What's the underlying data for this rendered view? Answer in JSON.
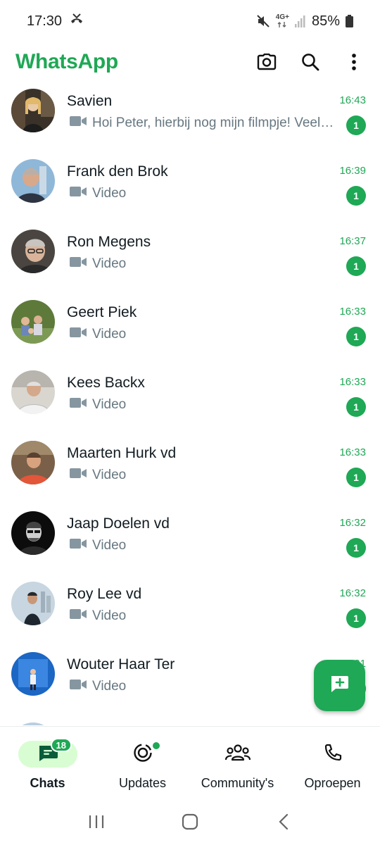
{
  "status_bar": {
    "time": "17:30",
    "network": "4G+",
    "battery": "85%"
  },
  "app": {
    "title": "WhatsApp",
    "camera_icon": "camera-icon",
    "search_icon": "search-icon",
    "menu_icon": "more-vert-icon"
  },
  "chats": [
    {
      "name": "Savien",
      "time": "16:43",
      "preview": "Hoi Peter, hierbij nog mijn filmpje! Veel succes",
      "unread": "1"
    },
    {
      "name": "Frank den Brok",
      "time": "16:39",
      "preview": "Video",
      "unread": "1"
    },
    {
      "name": "Ron Megens",
      "time": "16:37",
      "preview": "Video",
      "unread": "1"
    },
    {
      "name": "Geert Piek",
      "time": "16:33",
      "preview": "Video",
      "unread": "1"
    },
    {
      "name": "Kees Backx",
      "time": "16:33",
      "preview": "Video",
      "unread": "1"
    },
    {
      "name": "Maarten Hurk vd",
      "time": "16:33",
      "preview": "Video",
      "unread": "1"
    },
    {
      "name": "Jaap Doelen vd",
      "time": "16:32",
      "preview": "Video",
      "unread": "1"
    },
    {
      "name": "Roy Lee vd",
      "time": "16:32",
      "preview": "Video",
      "unread": "1"
    },
    {
      "name": "Wouter Haar Ter",
      "time": "16:31",
      "preview": "Video",
      "unread": "1"
    }
  ],
  "nav": {
    "chats": {
      "label": "Chats",
      "badge": "18"
    },
    "updates": {
      "label": "Updates"
    },
    "community": {
      "label": "Community's"
    },
    "calls": {
      "label": "Oproepen"
    }
  },
  "colors": {
    "accent": "#1fa855",
    "active_pill": "#d8fdd2"
  }
}
